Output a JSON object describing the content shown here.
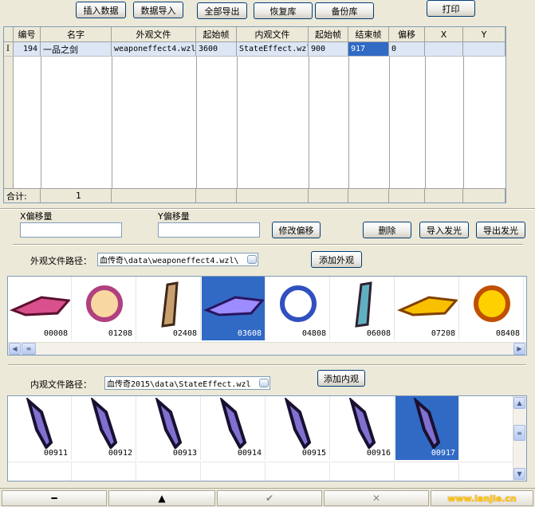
{
  "toolbar": {
    "insert": "插入数据",
    "import": "数据导入",
    "export_all": "全部导出",
    "restore": "恢复库",
    "backup": "备份库",
    "print": "打印"
  },
  "grid": {
    "columns": [
      "编号",
      "名字",
      "外观文件",
      "起始帧",
      "内观文件",
      "起始帧",
      "结束帧",
      "偏移",
      "X",
      "Y"
    ],
    "row_marker": "I",
    "row": [
      "194",
      "一品之剑",
      "weaponeffect4.wzl",
      "3600",
      "StateEffect.wzl",
      "900",
      "917",
      "0",
      "",
      ""
    ],
    "footer_label": "合计:",
    "footer_count": "1"
  },
  "offset": {
    "x_label": "X偏移量",
    "y_label": "Y偏移量",
    "x_value": "",
    "y_value": "",
    "modify": "修改偏移",
    "delete": "删除",
    "import_glow": "导入发光",
    "export_glow": "导出发光"
  },
  "outer": {
    "path_label": "外观文件路径：",
    "path_value": "\\血传奇\\data\\weaponeffect4.wzl",
    "add": "添加外观",
    "thumbs": [
      "00008",
      "01208",
      "02408",
      "03608",
      "04808",
      "06008",
      "07208",
      "08408"
    ],
    "selected": "03608"
  },
  "inner": {
    "path_label": "内观文件路径：",
    "path_value": "血传奇2015\\data\\StateEffect.wzl",
    "add": "添加内观",
    "thumbs": [
      "00911",
      "00912",
      "00913",
      "00914",
      "00915",
      "00916",
      "00917"
    ],
    "selected": "00917"
  },
  "nav": {
    "minus": "━",
    "up": "▲",
    "confirm": "✔",
    "cancel": "✕"
  },
  "watermark": "www.lanjie.cn",
  "colors": {
    "selection": "#316ac5",
    "window": "#ece9d8"
  }
}
